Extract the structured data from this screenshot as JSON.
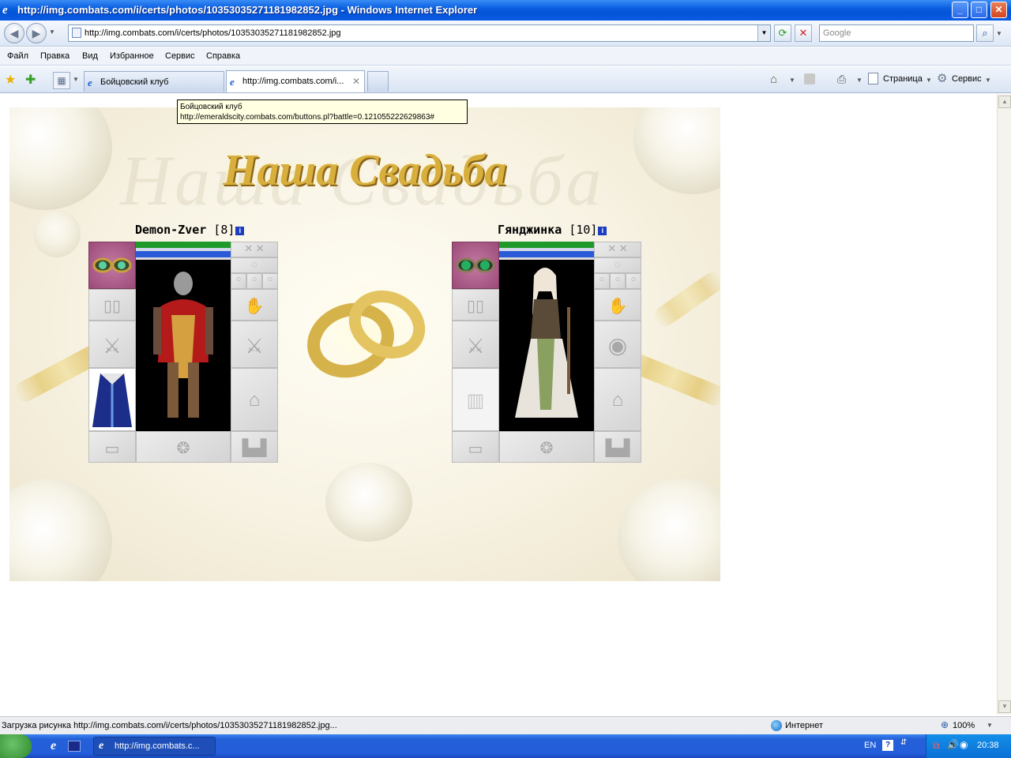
{
  "window": {
    "title": "http://img.combats.com/i/certs/photos/10353035271181982852.jpg - Windows Internet Explorer",
    "app_icon": "ie-icon",
    "controls": [
      "minimize-icon",
      "maximize-icon",
      "close-icon"
    ]
  },
  "address": {
    "url": "http://img.combats.com/i/certs/photos/10353035271181982852.jpg",
    "search_placeholder": "Google"
  },
  "menu": [
    "Файл",
    "Правка",
    "Вид",
    "Избранное",
    "Сервис",
    "Справка"
  ],
  "tabs": [
    {
      "label": "Бойцовский клуб",
      "active": false
    },
    {
      "label": "http://img.combats.com/i...",
      "active": true
    }
  ],
  "toolbar": {
    "page_label": "Страница",
    "tools_label": "Сервис"
  },
  "tooltip": {
    "line1": "Бойцовский клуб",
    "line2": "http://emeraldscity.combats.com/buttons.pl?battle=0.121055222629863#"
  },
  "card": {
    "title": "Наша Свадьба",
    "ghost_title": "Наша Свадьба",
    "players": [
      {
        "name": "Demon-Zver",
        "level": "[8]",
        "info": "i",
        "hp_color": "#1f9a2a",
        "mp_color": "#2a5ad8"
      },
      {
        "name": "Гянджинка",
        "level": "[10]",
        "info": "i",
        "hp_color": "#1f9a2a",
        "mp_color": "#2a5ad8"
      }
    ]
  },
  "status": {
    "text": "Загрузка рисунка http://img.combats.com/i/certs/photos/10353035271181982852.jpg...",
    "zone": "Интернет",
    "zoom": "100%"
  },
  "taskbar": {
    "task_label": "http://img.combats.c...",
    "lang": "EN",
    "time": "20:38"
  },
  "colors": {
    "titlebar": "#0a5fe0",
    "title_gold": "#d8ae3c",
    "slot_highlight": "#9c4a78"
  }
}
